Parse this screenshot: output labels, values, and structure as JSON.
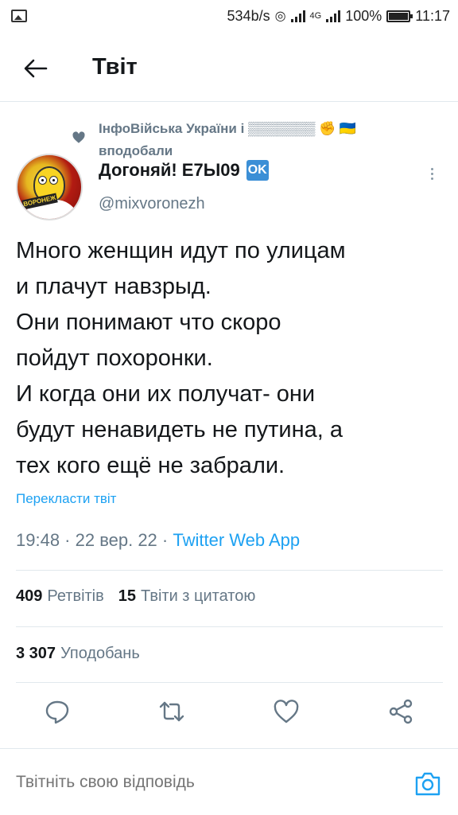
{
  "status_bar": {
    "net_speed": "534b/s",
    "network": "4G",
    "battery": "100%",
    "time": "11:17"
  },
  "header": {
    "title": "Твіт"
  },
  "social_context": {
    "text": "ІнфоВійська України і ▒▒▒▒▒▒▒ ✊ 🇺🇦 вподобали",
    "icon": "heart-icon"
  },
  "user": {
    "name": "Догоняй! Е7Ы09",
    "badge": "OK",
    "handle": "@mixvoronezh",
    "avatar_badge": "ВОРОНЕЖ"
  },
  "tweet": {
    "text": "Много женщин идут по улицам\nи плачут навзрыд.\nОни понимают что скоро\nпойдут похоронки.\nИ когда они их получат- они\nбудут ненавидеть не путина, а\nтех кого ещё не забрали.",
    "translate_link": "Перекласти твіт",
    "meta_time": "19:48 · 22 вер. 22 · ",
    "source": "Twitter Web App"
  },
  "stats": {
    "retweets_count": "409",
    "retweets_label": "Ретвітів",
    "quotes_count": "15",
    "quotes_label": "Твіти з цитатою",
    "likes_count": "3 307",
    "likes_label": "Уподобань"
  },
  "actions": [
    "reply-icon",
    "retweet-icon",
    "like-icon",
    "share-icon"
  ],
  "reply": {
    "placeholder": "Твітніть свою відповідь"
  },
  "colors": {
    "accent": "#1da1f2",
    "secondary_text": "#657786",
    "divider": "#e1e8ed"
  }
}
